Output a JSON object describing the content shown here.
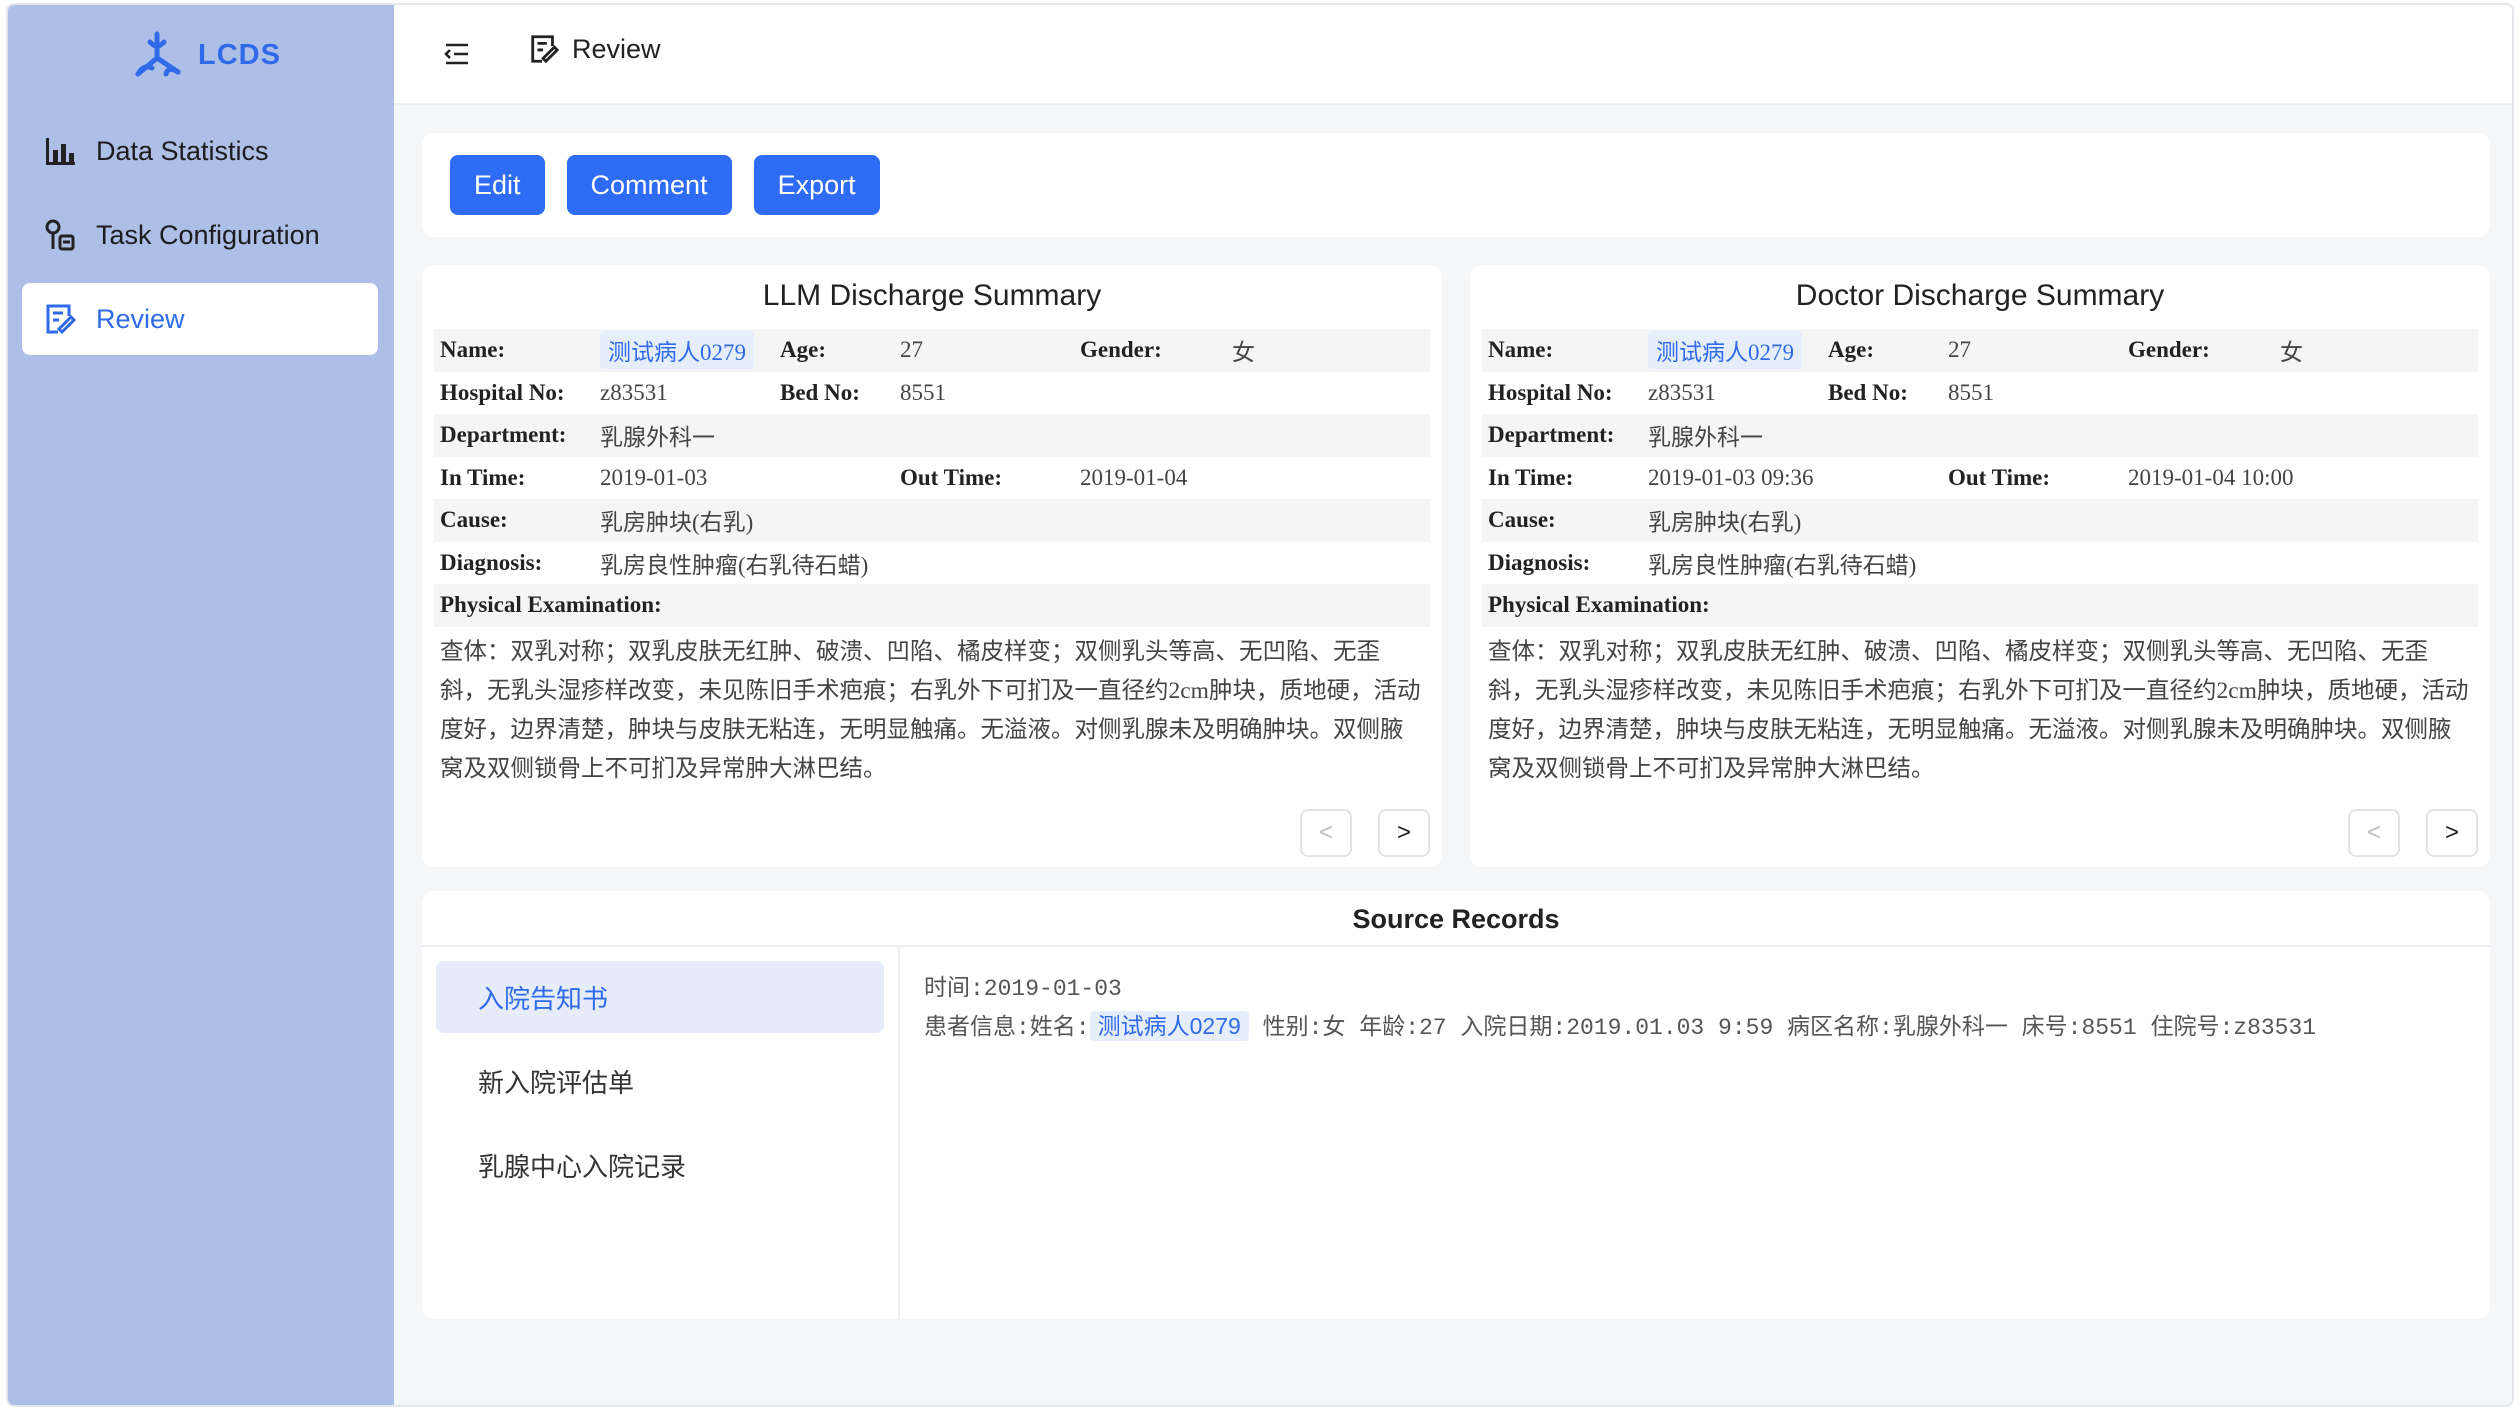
{
  "app": {
    "name": "LCDS",
    "brand_color": "#2f6be9",
    "sidebar_color": "#aebfe7"
  },
  "sidebar": {
    "items": [
      {
        "label": "Data Statistics",
        "icon": "bar-chart-icon"
      },
      {
        "label": "Task Configuration",
        "icon": "tools-icon"
      },
      {
        "label": "Review",
        "icon": "edit-doc-icon"
      }
    ]
  },
  "header": {
    "breadcrumb": "Review"
  },
  "toolbar": {
    "edit_label": "Edit",
    "comment_label": "Comment",
    "export_label": "Export"
  },
  "llm": {
    "title": "LLM Discharge Summary",
    "labels": {
      "name": "Name:",
      "age": "Age:",
      "gender": "Gender:",
      "hospital_no": "Hospital No:",
      "bed_no": "Bed No:",
      "department": "Department:",
      "in_time": "In Time:",
      "out_time": "Out Time:",
      "cause": "Cause:",
      "diagnosis": "Diagnosis:",
      "physical_exam": "Physical Examination:"
    },
    "name": "测试病人0279",
    "age": "27",
    "gender": "女",
    "hospital_no": "z83531",
    "bed_no": "8551",
    "department": "乳腺外科一",
    "in_time": "2019-01-03",
    "out_time": "2019-01-04",
    "cause": "乳房肿块(右乳)",
    "diagnosis": "乳房良性肿瘤(右乳待石蜡)",
    "physical_exam": "查体：双乳对称；双乳皮肤无红肿、破溃、凹陷、橘皮样变；双侧乳头等高、无凹陷、无歪斜，无乳头湿疹样改变，未见陈旧手术疤痕；右乳外下可扪及一直径约2cm肿块，质地硬，活动度好，边界清楚，肿块与皮肤无粘连，无明显触痛。无溢液。对侧乳腺未及明确肿块。双侧腋窝及双侧锁骨上不可扪及异常肿大淋巴结。",
    "pager": {
      "prev": "<",
      "next": ">"
    }
  },
  "doctor": {
    "title": "Doctor Discharge Summary",
    "labels": {
      "name": "Name:",
      "age": "Age:",
      "gender": "Gender:",
      "hospital_no": "Hospital No:",
      "bed_no": "Bed No:",
      "department": "Department:",
      "in_time": "In Time:",
      "out_time": "Out Time:",
      "cause": "Cause:",
      "diagnosis": "Diagnosis:",
      "physical_exam": "Physical Examination:"
    },
    "name": "测试病人0279",
    "age": "27",
    "gender": "女",
    "hospital_no": "z83531",
    "bed_no": "8551",
    "department": "乳腺外科一",
    "in_time": "2019-01-03 09:36",
    "out_time": "2019-01-04 10:00",
    "cause": "乳房肿块(右乳)",
    "diagnosis": "乳房良性肿瘤(右乳待石蜡)",
    "physical_exam": "查体：双乳对称；双乳皮肤无红肿、破溃、凹陷、橘皮样变；双侧乳头等高、无凹陷、无歪斜，无乳头湿疹样改变，未见陈旧手术疤痕；右乳外下可扪及一直径约2cm肿块，质地硬，活动度好，边界清楚，肿块与皮肤无粘连，无明显触痛。无溢液。对侧乳腺未及明确肿块。双侧腋窝及双侧锁骨上不可扪及异常肿大淋巴结。",
    "pager": {
      "prev": "<",
      "next": ">"
    }
  },
  "source": {
    "title": "Source Records",
    "items": [
      "入院告知书",
      "新入院评估单",
      "乳腺中心入院记录"
    ],
    "content": {
      "time_line": "时间:2019-01-03",
      "patient_prefix": "患者信息:姓名:",
      "patient_name": "测试病人0279",
      "patient_rest": "性别:女 年龄:27 入院日期:2019.01.03 9:59 病区名称:乳腺外科一 床号:8551 住院号:z83531"
    }
  }
}
